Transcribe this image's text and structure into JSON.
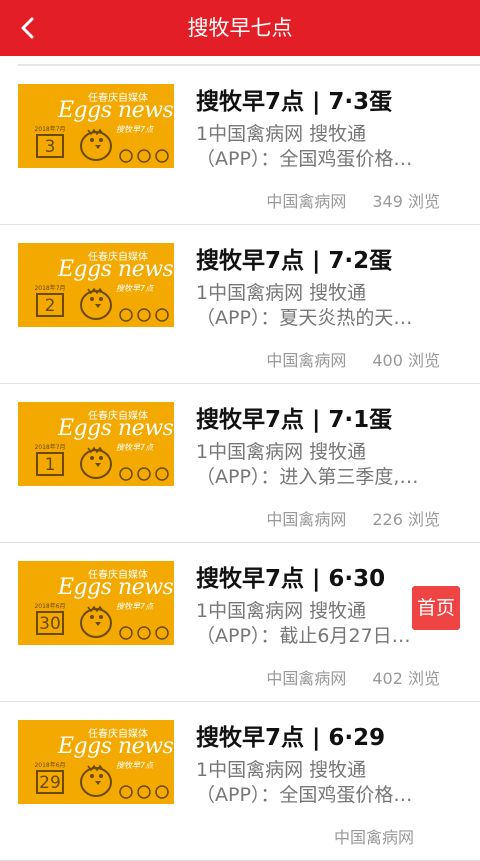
{
  "header": {
    "title": "搜牧早七点",
    "back_icon": "chevron-left-icon"
  },
  "thumbnail": {
    "brand_sub": "任春庆自媒体",
    "brand": "Eggs news",
    "tagline": "搜牧早7点"
  },
  "articles": [
    {
      "title": "搜牧早7点 | 7·3蛋",
      "desc_line1": "1中国禽病网 搜牧通",
      "desc_line2": "（APP）：全国鸡蛋价格…",
      "source": "中国禽病网",
      "views": "349 浏览",
      "cal_date": "2018年7月",
      "cal_day": "3"
    },
    {
      "title": "搜牧早7点 | 7·2蛋",
      "desc_line1": "1中国禽病网 搜牧通",
      "desc_line2": "（APP）：夏天炎热的天…",
      "source": "中国禽病网",
      "views": "400 浏览",
      "cal_date": "2018年7月",
      "cal_day": "2"
    },
    {
      "title": "搜牧早7点 | 7·1蛋",
      "desc_line1": "1中国禽病网 搜牧通",
      "desc_line2": "（APP）：进入第三季度,…",
      "source": "中国禽病网",
      "views": "226 浏览",
      "cal_date": "2018年7月",
      "cal_day": "1"
    },
    {
      "title": "搜牧早7点 | 6·30",
      "desc_line1": "1中国禽病网 搜牧通",
      "desc_line2": "（APP）：截止6月27日…",
      "source": "中国禽病网",
      "views": "402 浏览",
      "cal_date": "2018年6月",
      "cal_day": "30"
    },
    {
      "title": "搜牧早7点 | 6·29",
      "desc_line1": "1中国禽病网 搜牧通",
      "desc_line2": "（APP）：全国鸡蛋价格…",
      "source": "中国禽病网",
      "views": "",
      "cal_date": "2018年6月",
      "cal_day": "29"
    }
  ],
  "floating": {
    "home_label": "首页"
  },
  "colors": {
    "header": "#e41e26",
    "thumb_bg": "#f4a900",
    "home_button": "#ee3b3b"
  }
}
